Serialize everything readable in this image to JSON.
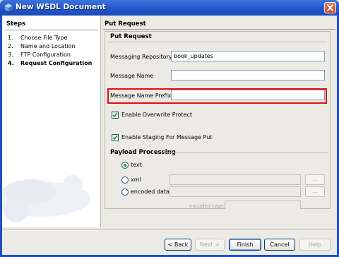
{
  "window": {
    "title": "New WSDL Document",
    "title_icon": "netbeans-cube-icon",
    "close_icon": "close-icon"
  },
  "steps": {
    "title": "Steps",
    "items": [
      {
        "num": "1.",
        "label": "Choose File Type",
        "current": false
      },
      {
        "num": "2.",
        "label": "Name and Location",
        "current": false
      },
      {
        "num": "3.",
        "label": "FTP Configuration",
        "current": false
      },
      {
        "num": "4.",
        "label": "Request Configuration",
        "current": true
      }
    ]
  },
  "page": {
    "title": "Put Request"
  },
  "put_request": {
    "group_title": "Put Request",
    "messaging_repository_label": "Messaging Repository",
    "messaging_repository_value": "book_updates",
    "message_name_label": "Message Name",
    "message_name_value": "",
    "message_name_prefix_label": "Message Name Prefix",
    "message_name_prefix_value": "",
    "enable_overwrite_protect_label": "Enable Overwrite Protect",
    "enable_overwrite_protect_checked": true,
    "enable_staging_label": "Enable Staging For Message Put",
    "enable_staging_checked": true
  },
  "payload": {
    "title": "Payload Processing",
    "options": [
      {
        "label": "text",
        "selected": true
      },
      {
        "label": "xml",
        "selected": false
      },
      {
        "label": "encoded data",
        "selected": false
      }
    ],
    "browse_label": "...",
    "encoded_type_label": "encoded type:"
  },
  "buttons": {
    "back": "< Back",
    "next": "Next >",
    "finish": "Finish",
    "cancel": "Cancel",
    "help": "Help"
  },
  "colors": {
    "title_bar": "#2a5bd2",
    "highlight_border": "#e01010",
    "radio_selected": "#21a121"
  }
}
